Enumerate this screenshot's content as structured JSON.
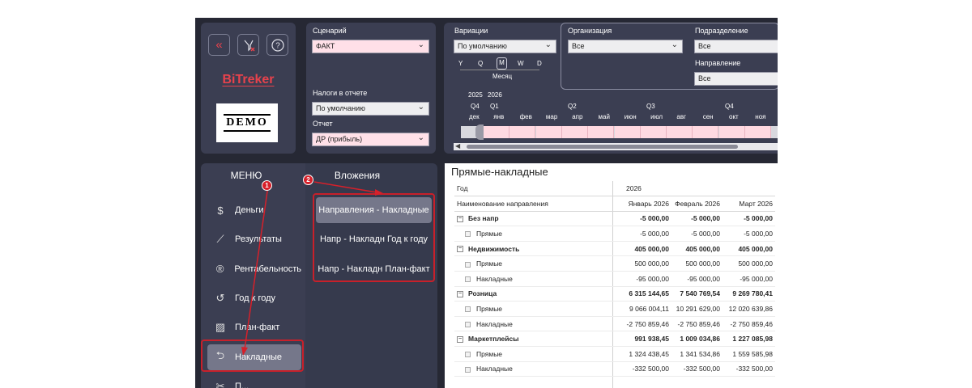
{
  "toolbar": {
    "back_icon": "double-chevron-left-icon",
    "clear_filters_icon": "clear-filter-icon",
    "help_icon": "question-circle-icon"
  },
  "brand": {
    "name": "BiTreker",
    "logo_text": "DEMO"
  },
  "filters": {
    "scenario": {
      "label": "Сценарий",
      "value": "ФАКТ"
    },
    "taxes": {
      "label": "Налоги в отчете",
      "value": "По умолчанию"
    },
    "report": {
      "label": "Отчет",
      "value": "ДР (прибыль)"
    },
    "variations": {
      "label": "Вариации",
      "value": "По умолчанию"
    },
    "organization": {
      "label": "Организация",
      "value": "Все"
    },
    "division": {
      "label": "Подразделение",
      "value": "Все"
    },
    "direction": {
      "label": "Направление",
      "value": "Все"
    }
  },
  "timeline": {
    "granularity": [
      "Y",
      "Q",
      "M",
      "W",
      "D"
    ],
    "selected_granularity": "M",
    "granularity_label": "Месяц",
    "years": [
      "2025",
      "2026"
    ],
    "quarters": [
      "Q4",
      "Q1",
      "Q2",
      "Q3",
      "Q4"
    ],
    "months": [
      "дек",
      "янв",
      "фев",
      "мар",
      "апр",
      "май",
      "июн",
      "июл",
      "авг",
      "сен",
      "окт",
      "ноя"
    ]
  },
  "menu": {
    "title": "МЕНЮ",
    "items": [
      {
        "label": "Деньги",
        "icon": "dollar-circle-icon"
      },
      {
        "label": "Результаты",
        "icon": "line-chart-icon"
      },
      {
        "label": "Рентабельность",
        "icon": "registered-circle-icon"
      },
      {
        "label": "Год к году",
        "icon": "history-icon"
      },
      {
        "label": "План-факт",
        "icon": "image-chart-icon"
      },
      {
        "label": "Накладные",
        "icon": "return-arrow-icon"
      },
      {
        "label": "П...",
        "icon": "scissors-icon"
      }
    ]
  },
  "submenu": {
    "title": "Вложения",
    "items": [
      "Направления - Накладные",
      "Напр - Накладн Год к году",
      "Напр - Накладн План-факт"
    ]
  },
  "annotations": {
    "badge1": "1",
    "badge2": "2",
    "accent": "#d6202a"
  },
  "report": {
    "title": "Прямые-накладные",
    "year_label": "Год",
    "year_value": "2026",
    "row_header": "Наименование направления",
    "columns": [
      "Январь 2026",
      "Февраль 2026",
      "Март 2026"
    ],
    "rows": [
      {
        "name": "Без напр",
        "group": true,
        "values": [
          "-5 000,00",
          "-5 000,00",
          "-5 000,00"
        ]
      },
      {
        "name": "Прямые",
        "group": false,
        "values": [
          "-5 000,00",
          "-5 000,00",
          "-5 000,00"
        ]
      },
      {
        "name": "Недвижимость",
        "group": true,
        "values": [
          "405 000,00",
          "405 000,00",
          "405 000,00"
        ]
      },
      {
        "name": "Прямые",
        "group": false,
        "values": [
          "500 000,00",
          "500 000,00",
          "500 000,00"
        ]
      },
      {
        "name": "Накладные",
        "group": false,
        "values": [
          "-95 000,00",
          "-95 000,00",
          "-95 000,00"
        ]
      },
      {
        "name": "Розница",
        "group": true,
        "values": [
          "6 315 144,65",
          "7 540 769,54",
          "9 269 780,41"
        ]
      },
      {
        "name": "Прямые",
        "group": false,
        "values": [
          "9 066 004,11",
          "10 291 629,00",
          "12 020 639,86"
        ]
      },
      {
        "name": "Накладные",
        "group": false,
        "values": [
          "-2 750 859,46",
          "-2 750 859,46",
          "-2 750 859,46"
        ]
      },
      {
        "name": "Маркетплейсы",
        "group": true,
        "values": [
          "991 938,45",
          "1 009 034,86",
          "1 227 085,98"
        ]
      },
      {
        "name": "Прямые",
        "group": false,
        "values": [
          "1 324 438,45",
          "1 341 534,86",
          "1 559 585,98"
        ]
      },
      {
        "name": "Накладные",
        "group": false,
        "values": [
          "-332 500,00",
          "-332 500,00",
          "-332 500,00"
        ]
      }
    ]
  }
}
